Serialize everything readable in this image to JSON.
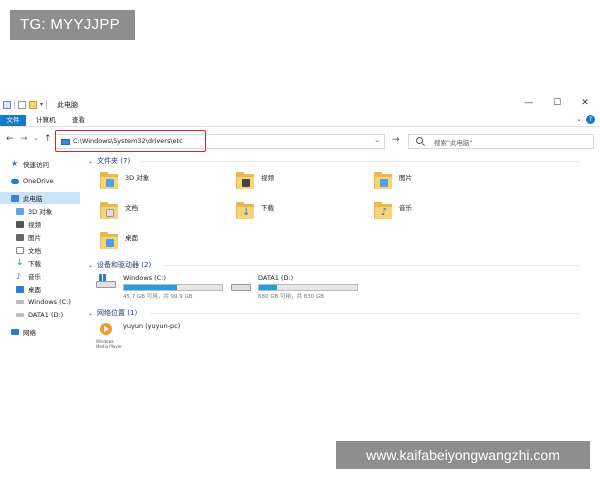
{
  "overlay": {
    "tg_badge": "TG: MYYJJPP",
    "watermark": "www.kaifabeiyongwangzhi.com"
  },
  "titlebar": {
    "title": "此电脑",
    "controls": [
      "—",
      "☐",
      "✕"
    ]
  },
  "ribbon": {
    "tabs": [
      "文件",
      "计算机",
      "查看"
    ]
  },
  "navbar": {
    "back": "←",
    "forward": "→",
    "recent": "⌄",
    "up": "↑",
    "address": "C:\\Windows\\System32\\drivers\\etc",
    "go": "→",
    "search_placeholder": "搜索\"此电脑\""
  },
  "sidebar": {
    "items": [
      {
        "label": "快速访问",
        "icon": "star-icon",
        "color": "#2b7cd3"
      },
      {
        "label": "OneDrive",
        "icon": "cloud-icon",
        "color": "#2b7cd3"
      },
      {
        "label": "此电脑",
        "icon": "computer-icon",
        "color": "#3a86d6",
        "selected": true
      },
      {
        "label": "3D 对象",
        "icon": "cube-icon",
        "color": "#3a86d6"
      },
      {
        "label": "视频",
        "icon": "video-icon",
        "color": "#555555"
      },
      {
        "label": "图片",
        "icon": "picture-icon",
        "color": "#555555"
      },
      {
        "label": "文档",
        "icon": "document-icon",
        "color": "#777777"
      },
      {
        "label": "下载",
        "icon": "download-icon",
        "color": "#2b7cd3"
      },
      {
        "label": "音乐",
        "icon": "music-icon",
        "color": "#2b7cd3"
      },
      {
        "label": "桌面",
        "icon": "desktop-icon",
        "color": "#2b7cd3"
      },
      {
        "label": "Windows (C:)",
        "icon": "drive-icon",
        "color": "#888888"
      },
      {
        "label": "DATA1 (D:)",
        "icon": "drive-icon",
        "color": "#888888"
      },
      {
        "label": "网络",
        "icon": "network-icon",
        "color": "#2b7cd3"
      }
    ]
  },
  "groups": {
    "folders": {
      "title": "文件夹 (7)"
    },
    "devices": {
      "title": "设备和驱动器 (2)"
    },
    "network": {
      "title": "网络位置 (1)"
    }
  },
  "folders": [
    {
      "label": "3D 对象",
      "icon": "3d-objects-icon",
      "badge_color": "#4aa3e8"
    },
    {
      "label": "视频",
      "icon": "videos-icon",
      "badge_color": "#444444"
    },
    {
      "label": "图片",
      "icon": "pictures-icon",
      "badge_color": "#4aa3e8"
    },
    {
      "label": "文档",
      "icon": "documents-icon",
      "badge_color": "#dddddd"
    },
    {
      "label": "下载",
      "icon": "downloads-icon",
      "badge_color": "#2b7cd3"
    },
    {
      "label": "音乐",
      "icon": "music-icon",
      "badge_color": "#2b7cd3"
    },
    {
      "label": "桌面",
      "icon": "desktop-icon",
      "badge_color": "#4aa3e8"
    }
  ],
  "drives": [
    {
      "name": "Windows (C:)",
      "free": "45.7 GB 可用，共 99.9 GB",
      "used_fraction": 0.54
    },
    {
      "name": "DATA1 (D:)",
      "free": "680 GB 可用，共 830 GB",
      "used_fraction": 0.18
    }
  ],
  "network_locations": [
    {
      "label": "yuyun (yuyun-pc)",
      "sub": "Windows Media Player"
    }
  ]
}
